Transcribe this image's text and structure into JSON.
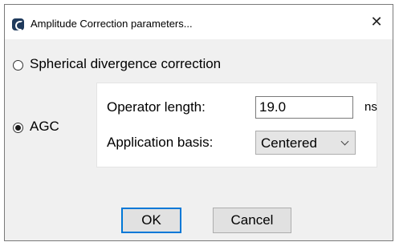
{
  "window": {
    "title": "Amplitude Correction parameters...",
    "close_glyph": "✕",
    "app_icon": "application-logo-icon"
  },
  "options": {
    "spherical": {
      "label": "Spherical divergence correction",
      "selected": false
    },
    "agc": {
      "label": "AGC",
      "selected": true
    }
  },
  "agc_panel": {
    "operator_length_label": "Operator length:",
    "operator_length_value": "19.0",
    "operator_length_unit": "ns",
    "application_basis_label": "Application basis:",
    "application_basis_value": "Centered"
  },
  "buttons": {
    "ok": "OK",
    "cancel": "Cancel"
  },
  "colors": {
    "default_button_border": "#0078d7",
    "dialog_background": "#f0f0f0",
    "panel_background": "#ffffff"
  }
}
